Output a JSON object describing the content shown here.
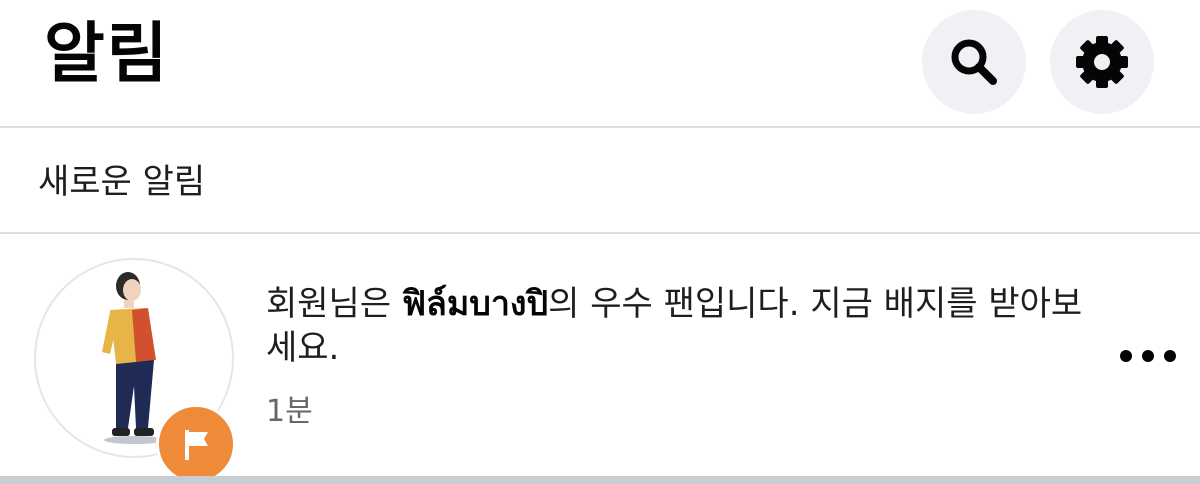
{
  "header": {
    "title": "알림",
    "search_icon": "search-icon",
    "settings_icon": "gear-icon"
  },
  "section": {
    "title": "새로운 알림"
  },
  "notification": {
    "text_prefix": "회원님은 ",
    "page_name": "ฟิล์มบางปิ",
    "text_suffix": "의 우수 팬입니다. 지금 배지를 받아보세요.",
    "time": "1분",
    "badge_icon": "flag-icon",
    "badge_color": "#ee8a38",
    "more_icon": "more-dots-icon"
  }
}
